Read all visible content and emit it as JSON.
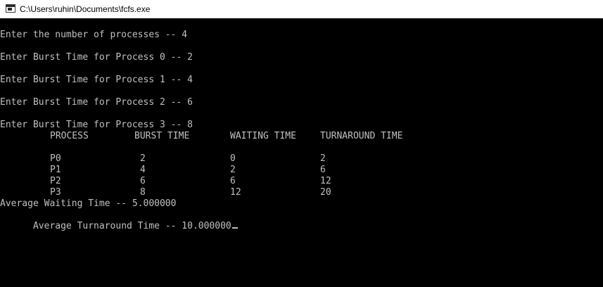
{
  "window": {
    "title": "C:\\Users\\ruhin\\Documents\\fcfs.exe",
    "icon": "console-app-icon"
  },
  "console": {
    "prompt_count": "Enter the number of processes -- 4",
    "prompts": [
      "Enter Burst Time for Process 0 -- 2",
      "Enter Burst Time for Process 1 -- 4",
      "Enter Burst Time for Process 2 -- 6",
      "Enter Burst Time for Process 3 -- 8"
    ],
    "table": {
      "headers": [
        "PROCESS",
        "BURST TIME",
        "WAITING TIME",
        "TURNAROUND TIME"
      ],
      "rows": [
        [
          "P0",
          "2",
          "0",
          "2"
        ],
        [
          "P1",
          "4",
          "2",
          "6"
        ],
        [
          "P2",
          "6",
          "6",
          "12"
        ],
        [
          "P3",
          "8",
          "12",
          "20"
        ]
      ]
    },
    "avg_waiting": "Average Waiting Time -- 5.000000",
    "avg_turnaround": "Average Turnaround Time -- 10.000000"
  },
  "colors": {
    "console_bg": "#000000",
    "console_text": "#c0c0c0",
    "titlebar_bg": "#ffffff"
  }
}
